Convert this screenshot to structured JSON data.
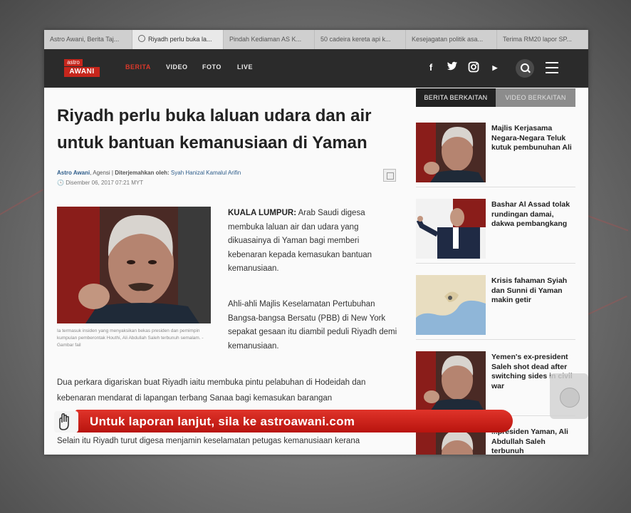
{
  "browser": {
    "tabs": [
      {
        "label": "Astro Awani, Berita Taj..."
      },
      {
        "label": "Riyadh perlu buka la..."
      },
      {
        "label": "Pindah Kediaman AS K..."
      },
      {
        "label": "50 cadeira kereta api k..."
      },
      {
        "label": "Kesejagatan politik asa..."
      },
      {
        "label": "Terima RM20 lapor SP..."
      }
    ]
  },
  "site": {
    "logo_top": "astro",
    "logo_bottom": "AWANI",
    "nav": [
      {
        "label": "BERITA"
      },
      {
        "label": "VIDEO"
      },
      {
        "label": "FOTO"
      },
      {
        "label": "LIVE"
      }
    ],
    "social": {
      "facebook": "f",
      "youtube": "▶"
    }
  },
  "article": {
    "headline": "Riyadh perlu buka laluan udara dan air untuk bantuan kemanusiaan di Yaman",
    "author": "Astro Awani",
    "agency": ", Agensi | ",
    "translated_label": "Diterjemahkan oleh: ",
    "translator": "Syah Hanizal Kamalul Arifin",
    "date": "Disember 06, 2017 07:21 MYT",
    "caption": "Ia termasuk insiden yang menyaksikan bekas presiden dan pemimpin kumpulan pemberontak Houthi, Ali Abdullah Saleh terbunuh semalam. - Gambar fail",
    "lead_location": "KUALA LUMPUR:",
    "lead_text": " Arab Saudi digesa membuka laluan air dan udara yang dikuasainya di Yaman bagi memberi kebenaran kepada kemasukan bantuan kemanusiaan.",
    "para2": "Ahli-ahli Majlis Keselamatan Pertubuhan Bangsa-bangsa Bersatu (PBB) di New York sepakat gesaan itu diambil peduli Riyadh demi kemanusiaan.",
    "para3": "Dua perkara digariskan buat Riyadh iaitu membuka pintu pelabuhan di Hodeidah dan kebenaran mendarat di lapangan terbang Sanaa bagi kemasukan barangan",
    "para4": "Selain itu Riyadh turut digesa menjamin keselamatan petugas kemanusiaan kerana"
  },
  "sidebar": {
    "tabs": [
      {
        "label": "BERITA BERKAITAN"
      },
      {
        "label": "VIDEO BERKAITAN"
      }
    ],
    "items": [
      {
        "title": "Majlis Kerjasama Negara-Negara Teluk kutuk pembunuhan Ali"
      },
      {
        "title": "Bashar Al Assad tolak rundingan damai, dakwa pembangkang"
      },
      {
        "title": "Krisis fahaman Syiah dan Sunni di Yaman makin getir"
      },
      {
        "title": "Yemen's ex-president Saleh shot dead after switching sides in civil war"
      },
      {
        "title": "...presiden Yaman, Ali Abdullah Saleh terbunuh"
      }
    ]
  },
  "ticker": {
    "text": "Untuk laporan lanjut, sila ke astroawani.com"
  },
  "colors": {
    "brand_red": "#c7261c",
    "nav_bg": "#2b2b2b",
    "ticker_red": "#d0241b",
    "link_blue": "#2d5c8a"
  }
}
